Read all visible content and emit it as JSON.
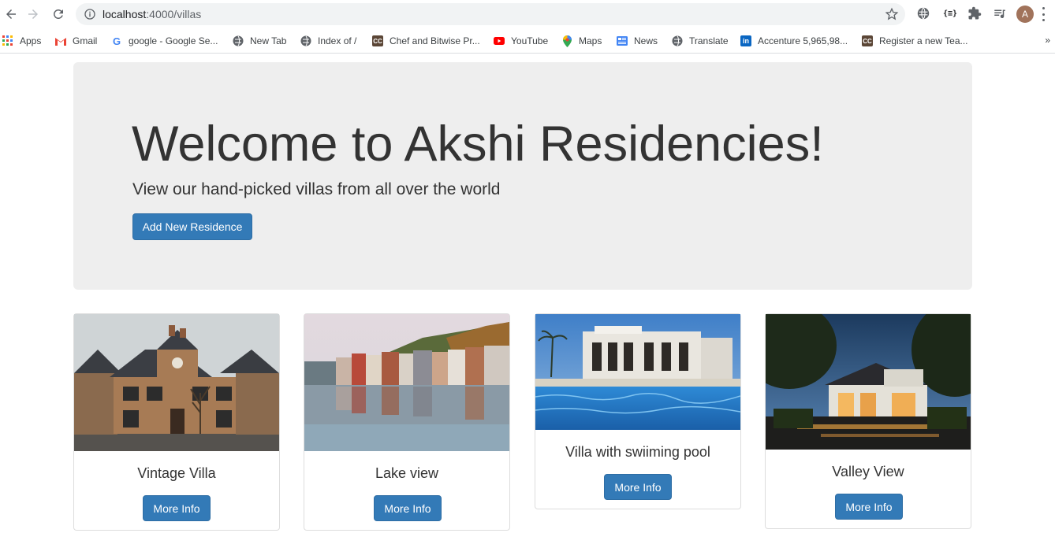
{
  "browser": {
    "url_host": "localhost",
    "url_path": ":4000/villas",
    "avatar_letter": "A",
    "bookmarks": [
      {
        "label": "Apps",
        "icon": "apps-grid-icon"
      },
      {
        "label": "Gmail",
        "icon": "gmail-icon"
      },
      {
        "label": "google - Google Se...",
        "icon": "google-icon"
      },
      {
        "label": "New Tab",
        "icon": "globe-icon"
      },
      {
        "label": "Index of /",
        "icon": "globe-icon"
      },
      {
        "label": "Chef and Bitwise Pr...",
        "icon": "cc-icon"
      },
      {
        "label": "YouTube",
        "icon": "youtube-icon"
      },
      {
        "label": "Maps",
        "icon": "maps-pin-icon"
      },
      {
        "label": "News",
        "icon": "news-icon"
      },
      {
        "label": "Translate",
        "icon": "globe-icon"
      },
      {
        "label": "Accenture 5,965,98...",
        "icon": "linkedin-icon"
      },
      {
        "label": "Register a new Tea...",
        "icon": "cc-icon"
      }
    ],
    "bookmarks_more": "»"
  },
  "hero": {
    "title": "Welcome to Akshi Residencies!",
    "subtitle": "View our hand-picked villas from all over the world",
    "button_label": "Add New Residence"
  },
  "villas": [
    {
      "name": "Vintage Villa",
      "button_label": "More Info"
    },
    {
      "name": "Lake view",
      "button_label": "More Info"
    },
    {
      "name": "Villa with swiiming pool",
      "button_label": "More Info"
    },
    {
      "name": "Valley View",
      "button_label": "More Info"
    }
  ],
  "colors": {
    "primary": "#337ab7",
    "jumbotron_bg": "#eeeeee"
  }
}
